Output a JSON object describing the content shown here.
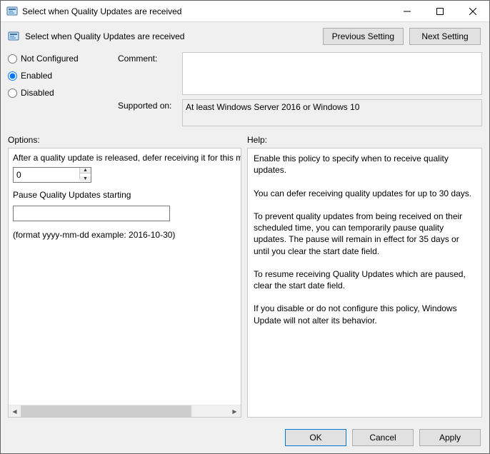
{
  "window": {
    "title": "Select when Quality Updates are received"
  },
  "header": {
    "title": "Select when Quality Updates are received",
    "previous_setting": "Previous Setting",
    "next_setting": "Next Setting"
  },
  "state_radio": {
    "not_configured": "Not Configured",
    "enabled": "Enabled",
    "disabled": "Disabled",
    "selected": "enabled"
  },
  "comment": {
    "label": "Comment:",
    "value": ""
  },
  "supported": {
    "label": "Supported on:",
    "value": "At least Windows Server 2016 or Windows 10"
  },
  "section_labels": {
    "options": "Options:",
    "help": "Help:"
  },
  "options": {
    "defer_label": "After a quality update is released, defer receiving it for this many days:",
    "defer_value": "0",
    "pause_label": "Pause Quality Updates starting",
    "pause_value": "",
    "format_hint": "(format yyyy-mm-dd example: 2016-10-30)"
  },
  "help_text": "Enable this policy to specify when to receive quality updates.\n\nYou can defer receiving quality updates for up to 30 days.\n\nTo prevent quality updates from being received on their scheduled time, you can temporarily pause quality updates. The pause will remain in effect for 35 days or until you clear the start date field.\n\nTo resume receiving Quality Updates which are paused, clear the start date field.\n\nIf you disable or do not configure this policy, Windows Update will not alter its behavior.",
  "footer": {
    "ok": "OK",
    "cancel": "Cancel",
    "apply": "Apply"
  }
}
